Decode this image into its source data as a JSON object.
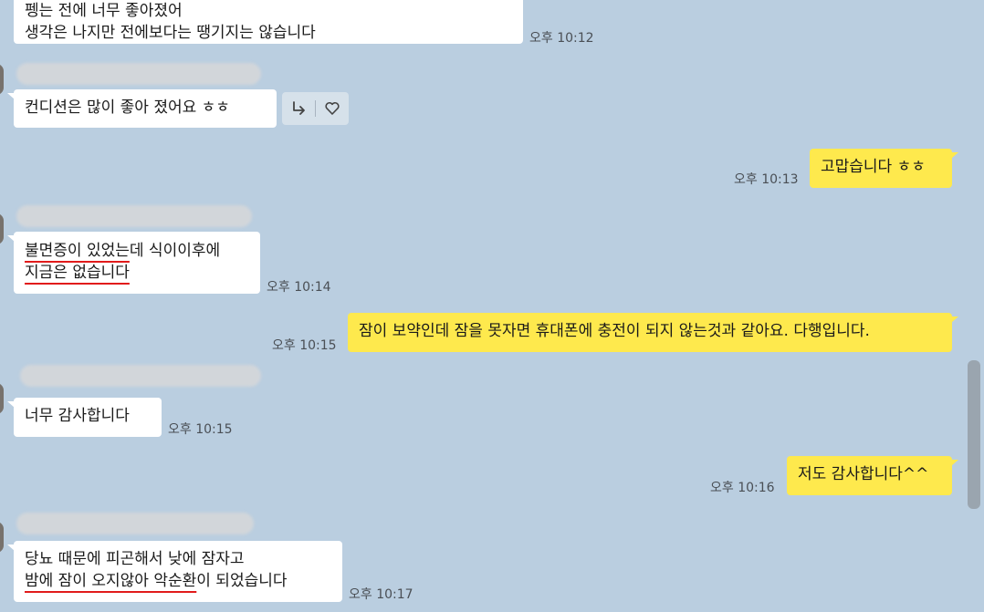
{
  "messages": [
    {
      "id": "m1",
      "side": "in",
      "lines": [
        "펭는 전에 너무 좋아졌어",
        "생각은 나지만 전에보다는 땡기지는 않습니다"
      ],
      "time": "오후 10:12"
    },
    {
      "id": "m2",
      "side": "in",
      "lines": [
        "컨디션은 많이 좋아 졌어요 ㅎㅎ"
      ]
    },
    {
      "id": "m3",
      "side": "out",
      "lines": [
        "고맙습니다 ㅎㅎ"
      ],
      "time": "오후 10:13"
    },
    {
      "id": "m4",
      "side": "in",
      "lines": [
        "불면증이 있었는데 식이이후에",
        "지금은 없습니다"
      ],
      "time": "오후 10:14"
    },
    {
      "id": "m5",
      "side": "out",
      "lines": [
        "잠이 보약인데 잠을 못자면 휴대폰에 충전이 되지 않는것과 같아요. 다행입니다."
      ],
      "time": "오후 10:15"
    },
    {
      "id": "m6",
      "side": "in",
      "lines": [
        "너무 감사합니다"
      ],
      "time": "오후 10:15"
    },
    {
      "id": "m7",
      "side": "out",
      "lines": [
        "저도 감사합니다^^"
      ],
      "time": "오후 10:16"
    },
    {
      "id": "m8",
      "side": "in",
      "lines": [
        "당뇨 때문에 피곤해서 낮에 잠자고",
        "밤에 잠이 오지않아 악순환이 되었습니다"
      ],
      "time": "오후 10:17"
    }
  ],
  "m4_underlined": [
    "불면증이 있었는",
    "지금은 없습니다"
  ],
  "m4_rest": [
    "데 식이이후에",
    ""
  ],
  "m8_line2_underlined": "밤에 잠이 오지않아 악순환",
  "m8_line2_rest": "이 되었습니다",
  "reaction_icons": [
    "reply-arrow-icon",
    "heart-icon"
  ],
  "colors": {
    "background": "#bacee0",
    "incoming": "#ffffff",
    "outgoing": "#fee94d",
    "underline": "#e11b1b"
  }
}
